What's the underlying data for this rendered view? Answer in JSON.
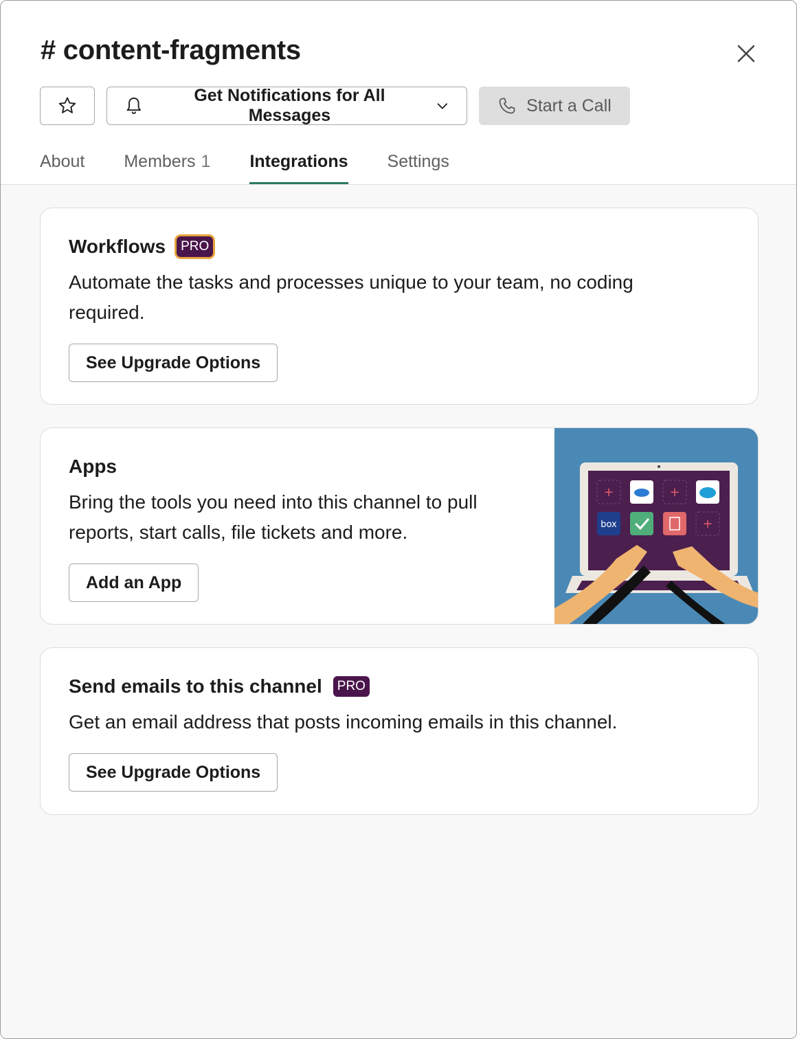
{
  "header": {
    "title": "# content-fragments",
    "notify_label": "Get Notifications for All Messages",
    "call_label": "Start a Call"
  },
  "tabs": [
    {
      "label": "About"
    },
    {
      "label": "Members",
      "count": "1"
    },
    {
      "label": "Integrations",
      "active": true
    },
    {
      "label": "Settings"
    }
  ],
  "cards": {
    "workflows": {
      "title": "Workflows",
      "badge": "PRO",
      "description": "Automate the tasks and processes unique to your team, no coding required.",
      "button": "See Upgrade Options"
    },
    "apps": {
      "title": "Apps",
      "description": "Bring the tools you need into this channel to pull reports, start calls, file tickets and more.",
      "button": "Add an App",
      "illustration_label": "box"
    },
    "email": {
      "title": "Send emails to this channel",
      "badge": "PRO",
      "description": "Get an email address that posts incoming emails in this channel.",
      "button": "See Upgrade Options"
    }
  },
  "colors": {
    "accent_tab": "#2b7a5f",
    "pro_badge": "#4a154b",
    "pro_outline": "#e8a33d",
    "illustration_bg": "#4a89b5"
  },
  "icons": [
    "star-icon",
    "bell-icon",
    "chevron-down-icon",
    "phone-icon",
    "close-icon"
  ]
}
